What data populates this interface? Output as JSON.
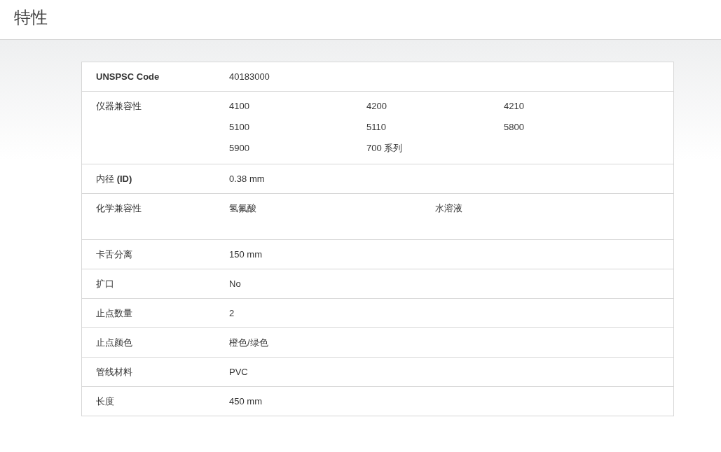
{
  "page_title": "特性",
  "properties": [
    {
      "label": "UNSPSC Code",
      "label_bold": true,
      "kind": "single",
      "values": [
        "40183000"
      ]
    },
    {
      "label": "仪器兼容性",
      "label_bold": false,
      "kind": "grid",
      "values": [
        "4100",
        "4200",
        "4210",
        "5100",
        "5110",
        "5800",
        "5900",
        "700 系列"
      ]
    },
    {
      "label": "内径 **(ID)**",
      "label_bold": false,
      "kind": "single",
      "values": [
        "0.38 mm"
      ]
    },
    {
      "label": "化学兼容性",
      "label_bold": false,
      "kind": "pair",
      "values": [
        "氢氟酸",
        "水溶液"
      ]
    },
    {
      "label": "卡舌分离",
      "label_bold": false,
      "kind": "single",
      "values": [
        "150 mm"
      ]
    },
    {
      "label": "扩口",
      "label_bold": false,
      "kind": "single",
      "values": [
        "No"
      ]
    },
    {
      "label": "止点数量",
      "label_bold": false,
      "kind": "single",
      "values": [
        "2"
      ]
    },
    {
      "label": "止点颜色",
      "label_bold": false,
      "kind": "single",
      "values": [
        "橙色/绿色"
      ]
    },
    {
      "label": "管线材料",
      "label_bold": false,
      "kind": "single",
      "values": [
        "PVC"
      ]
    },
    {
      "label": "长度",
      "label_bold": false,
      "kind": "single",
      "values": [
        "450 mm"
      ]
    }
  ]
}
